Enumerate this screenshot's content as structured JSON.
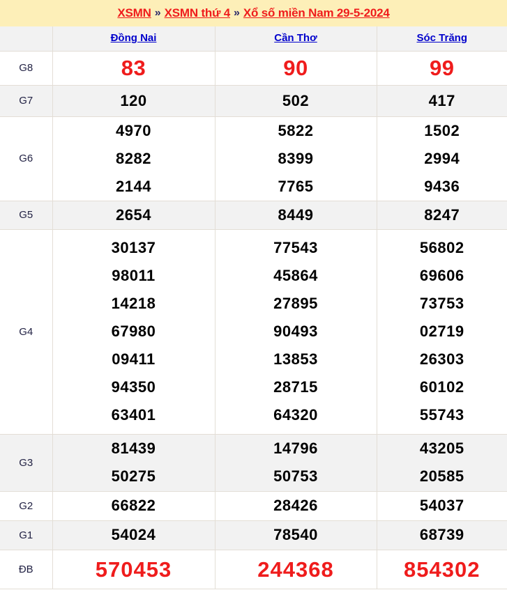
{
  "breadcrumb": {
    "separator": "»",
    "items": [
      {
        "label": "XSMN"
      },
      {
        "label": "XSMN thứ 4"
      },
      {
        "label": "Xổ số miền Nam 29-5-2024"
      }
    ]
  },
  "colors": {
    "header_bg": "#fdefb8",
    "crumb_link": "#ef1c1c",
    "crumb_sep": "#2a2a6a",
    "province_link": "#0000cc",
    "number": "#000000",
    "highlight_number": "#ef1c1c",
    "row_shade": "#f2f2f2",
    "row_plain": "#ffffff",
    "border": "#e3ded6"
  },
  "table": {
    "corner_label": "",
    "provinces": [
      {
        "name": "Đồng Nai"
      },
      {
        "name": "Cần Thơ"
      },
      {
        "name": "Sóc Trăng"
      }
    ],
    "rows": [
      {
        "prize": "G8",
        "style": "big-red",
        "values": [
          [
            "83"
          ],
          [
            "90"
          ],
          [
            "99"
          ]
        ]
      },
      {
        "prize": "G7",
        "style": "normal",
        "values": [
          [
            "120"
          ],
          [
            "502"
          ],
          [
            "417"
          ]
        ]
      },
      {
        "prize": "G6",
        "style": "normal",
        "values": [
          [
            "4970",
            "8282",
            "2144"
          ],
          [
            "5822",
            "8399",
            "7765"
          ],
          [
            "1502",
            "2994",
            "9436"
          ]
        ]
      },
      {
        "prize": "G5",
        "style": "normal",
        "values": [
          [
            "2654"
          ],
          [
            "8449"
          ],
          [
            "8247"
          ]
        ]
      },
      {
        "prize": "G4",
        "style": "normal",
        "values": [
          [
            "30137",
            "98011",
            "14218",
            "67980",
            "09411",
            "94350",
            "63401"
          ],
          [
            "77543",
            "45864",
            "27895",
            "90493",
            "13853",
            "28715",
            "64320"
          ],
          [
            "56802",
            "69606",
            "73753",
            "02719",
            "26303",
            "60102",
            "55743"
          ]
        ]
      },
      {
        "prize": "G3",
        "style": "normal",
        "values": [
          [
            "81439",
            "50275"
          ],
          [
            "14796",
            "50753"
          ],
          [
            "43205",
            "20585"
          ]
        ]
      },
      {
        "prize": "G2",
        "style": "normal",
        "values": [
          [
            "66822"
          ],
          [
            "28426"
          ],
          [
            "54037"
          ]
        ]
      },
      {
        "prize": "G1",
        "style": "normal",
        "values": [
          [
            "54024"
          ],
          [
            "78540"
          ],
          [
            "68739"
          ]
        ]
      },
      {
        "prize": "ĐB",
        "style": "special",
        "values": [
          [
            "570453"
          ],
          [
            "244368"
          ],
          [
            "854302"
          ]
        ]
      }
    ]
  }
}
